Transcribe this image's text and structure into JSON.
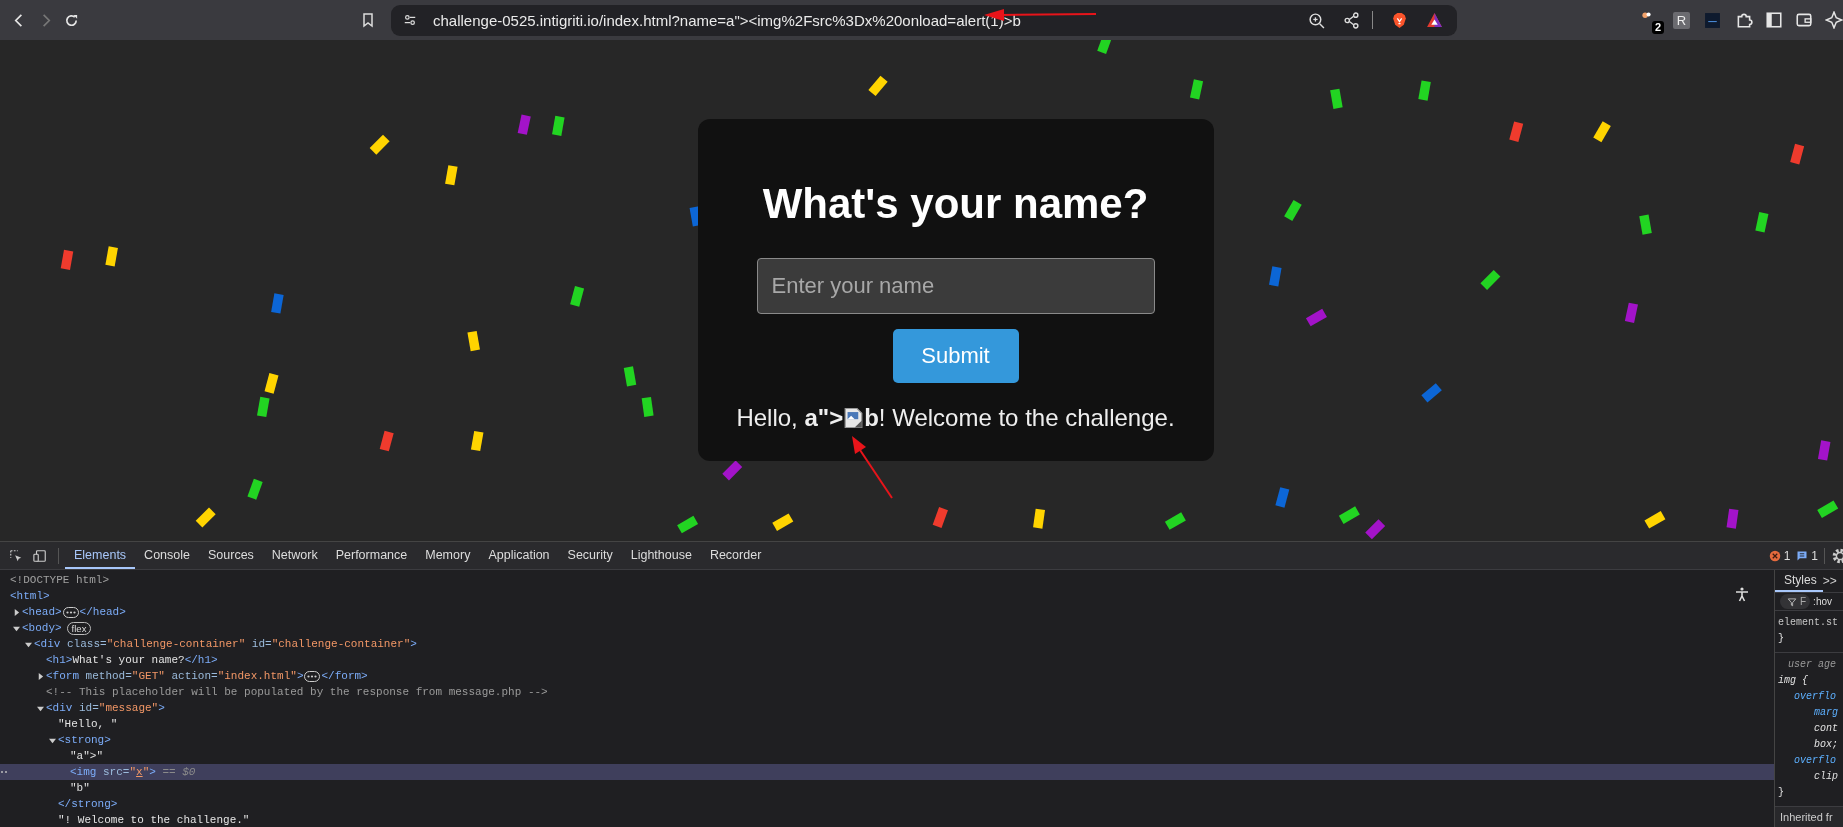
{
  "browser": {
    "url": "challenge-0525.intigriti.io/index.html?name=a\"><img%2Fsrc%3Dx%20onload=alert(1)>b",
    "back_enabled": true,
    "forward_enabled": false,
    "extension_badge": "2",
    "extension_letter": "R"
  },
  "page": {
    "heading": "What's your name?",
    "input": {
      "placeholder": "Enter your name"
    },
    "submit": "Submit",
    "message": [
      {
        "kind": "text",
        "text": "Hello, "
      },
      {
        "kind": "bold",
        "text": "a\">"
      },
      {
        "kind": "broken-image"
      },
      {
        "kind": "bold",
        "text": "b"
      },
      {
        "kind": "text",
        "text": "! Welcome to the challenge."
      }
    ]
  },
  "devtools": {
    "tabs": [
      {
        "label": "Elements",
        "selected": true
      },
      {
        "label": "Console",
        "selected": false
      },
      {
        "label": "Sources",
        "selected": false
      },
      {
        "label": "Network",
        "selected": false
      },
      {
        "label": "Performance",
        "selected": false
      },
      {
        "label": "Memory",
        "selected": false
      },
      {
        "label": "Application",
        "selected": false
      },
      {
        "label": "Security",
        "selected": false
      },
      {
        "label": "Lighthouse",
        "selected": false
      },
      {
        "label": "Recorder",
        "selected": false
      }
    ],
    "error_count": "1",
    "message_count": "1",
    "dom": [
      {
        "selected": false,
        "parts": [
          {
            "kind": "doctype",
            "text": "<!DOCTYPE html>"
          }
        ]
      },
      {
        "selected": false,
        "parts": [
          {
            "kind": "tag",
            "text": "<html>"
          }
        ],
        "children": [
          {
            "selected": false,
            "expanded": false,
            "parts": [
              {
                "kind": "tag",
                "text": "<head>"
              },
              {
                "kind": "ellipsis"
              },
              {
                "kind": "tag",
                "text": "</head>"
              }
            ]
          },
          {
            "selected": false,
            "expanded": true,
            "parts": [
              {
                "kind": "tag",
                "text": "<body>"
              },
              {
                "kind": "badge",
                "text": "flex"
              }
            ],
            "children": [
              {
                "selected": false,
                "expanded": true,
                "parts": [
                  {
                    "kind": "tag",
                    "text": "<div"
                  },
                  {
                    "kind": "attr",
                    "text": " class="
                  },
                  {
                    "kind": "value",
                    "text": "\"challenge-container\""
                  },
                  {
                    "kind": "attr",
                    "text": " id="
                  },
                  {
                    "kind": "value",
                    "text": "\"challenge-container\""
                  },
                  {
                    "kind": "tag",
                    "text": ">"
                  }
                ],
                "children": [
                  {
                    "selected": false,
                    "parts": [
                      {
                        "kind": "tag",
                        "text": "<h1>"
                      },
                      {
                        "kind": "text",
                        "text": "What's your name?"
                      },
                      {
                        "kind": "tag",
                        "text": "</h1>"
                      }
                    ]
                  },
                  {
                    "selected": false,
                    "expanded": false,
                    "parts": [
                      {
                        "kind": "tag",
                        "text": "<form"
                      },
                      {
                        "kind": "attr",
                        "text": " method="
                      },
                      {
                        "kind": "value",
                        "text": "\"GET\""
                      },
                      {
                        "kind": "attr",
                        "text": " action="
                      },
                      {
                        "kind": "value",
                        "text": "\"index.html\""
                      },
                      {
                        "kind": "tag",
                        "text": ">"
                      },
                      {
                        "kind": "ellipsis"
                      },
                      {
                        "kind": "tag",
                        "text": "</form>"
                      }
                    ]
                  },
                  {
                    "selected": false,
                    "parts": [
                      {
                        "kind": "comment",
                        "text": "<!-- This placeholder will be populated by the response from message.php -->"
                      }
                    ]
                  },
                  {
                    "selected": false,
                    "expanded": true,
                    "parts": [
                      {
                        "kind": "tag",
                        "text": "<div"
                      },
                      {
                        "kind": "attr",
                        "text": " id="
                      },
                      {
                        "kind": "value",
                        "text": "\"message\""
                      },
                      {
                        "kind": "tag",
                        "text": ">"
                      }
                    ],
                    "children": [
                      {
                        "selected": false,
                        "parts": [
                          {
                            "kind": "text",
                            "text": "\"Hello, \""
                          }
                        ]
                      },
                      {
                        "selected": false,
                        "expanded": true,
                        "closing": "</strong>",
                        "parts": [
                          {
                            "kind": "tag",
                            "text": "<strong>"
                          }
                        ],
                        "children": [
                          {
                            "selected": false,
                            "parts": [
                              {
                                "kind": "text",
                                "text": "\"a\">\""
                              }
                            ]
                          },
                          {
                            "selected": true,
                            "parts": [
                              {
                                "kind": "tag",
                                "text": "<img"
                              },
                              {
                                "kind": "attr",
                                "text": " src="
                              },
                              {
                                "kind": "value",
                                "text": "\""
                              },
                              {
                                "kind": "link",
                                "text": "x"
                              },
                              {
                                "kind": "value",
                                "text": "\""
                              },
                              {
                                "kind": "tag",
                                "text": ">"
                              },
                              {
                                "kind": "hint",
                                "text": " == $0"
                              }
                            ]
                          },
                          {
                            "selected": false,
                            "parts": [
                              {
                                "kind": "text",
                                "text": "\"b\""
                              }
                            ]
                          }
                        ]
                      },
                      {
                        "selected": false,
                        "parts": [
                          {
                            "kind": "text",
                            "text": "\"! Welcome to the challenge.\""
                          }
                        ]
                      }
                    ]
                  }
                ]
              }
            ]
          }
        ]
      }
    ],
    "styles": {
      "tabs": [
        {
          "label": "Styles",
          "selected": true
        }
      ],
      "more": ">>",
      "filter_placeholder": "F",
      "hov": ":hov",
      "rules": [
        {
          "lines": [
            {
              "kind": "selector",
              "text": "element.st"
            },
            {
              "kind": "brace",
              "text": "}"
            }
          ]
        },
        {
          "lines": [
            {
              "kind": "origin",
              "text": "user age"
            },
            {
              "kind": "ua-selector",
              "text": "img {"
            },
            {
              "kind": "prop",
              "text": "overflo"
            },
            {
              "kind": "prop-wrap",
              "text": "marg"
            },
            {
              "kind": "value-wrap",
              "text": "cont"
            },
            {
              "kind": "value-wrap",
              "text": "box;"
            },
            {
              "kind": "prop",
              "text": "overflo"
            },
            {
              "kind": "value-wrap",
              "text": "clip"
            },
            {
              "kind": "brace",
              "text": "}"
            }
          ]
        }
      ],
      "inherited": "Inherited fr"
    }
  }
}
